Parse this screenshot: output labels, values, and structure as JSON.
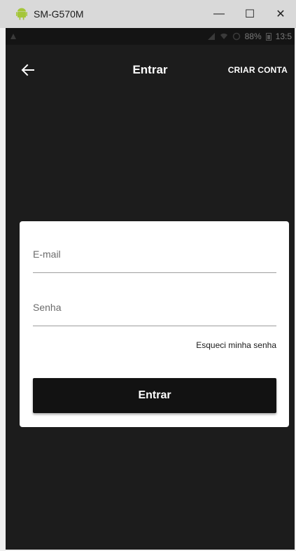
{
  "window": {
    "title": "SM-G570M",
    "controls": {
      "minimize": "—",
      "maximize": "☐",
      "close": "✕"
    }
  },
  "statusbar": {
    "battery_percent": "88%",
    "time": "13:5"
  },
  "appbar": {
    "title": "Entrar",
    "create_account": "CRIAR CONTA"
  },
  "form": {
    "email_label": "E-mail",
    "email_value": "",
    "password_label": "Senha",
    "password_value": "",
    "forgot_password": "Esqueci minha senha",
    "submit_label": "Entrar"
  },
  "colors": {
    "background": "#1c1c1c",
    "card": "#ffffff",
    "button": "#121212",
    "android_green": "#a4c639"
  },
  "icons": {
    "app": "android-icon",
    "back": "arrow-left-icon",
    "status_left": "notification-icon",
    "signal": "signal-icon",
    "wifi": "wifi-icon",
    "sync": "sync-icon",
    "battery": "battery-icon"
  }
}
